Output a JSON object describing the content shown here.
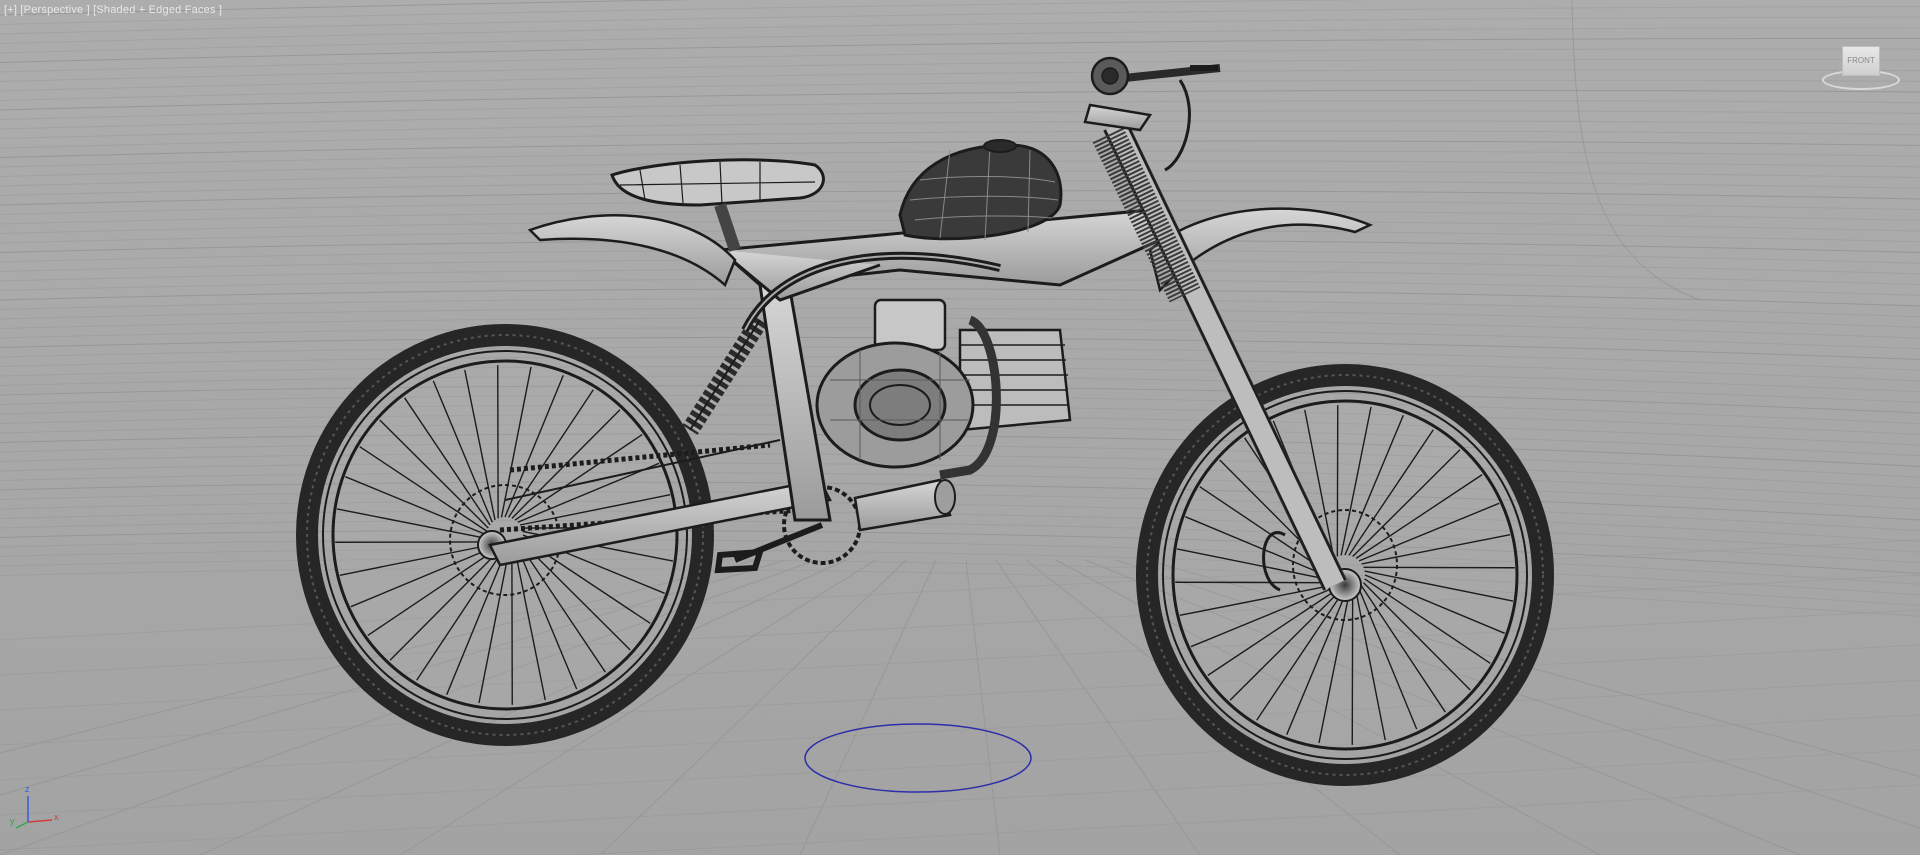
{
  "viewport": {
    "menu_label": "[+]",
    "view_label": "[Perspective ]",
    "shading_label": "[Shaded + Edged Faces ]",
    "viewcube_face": "FRONT",
    "axes": {
      "x": "x",
      "y": "y",
      "z": "z"
    }
  },
  "scene": {
    "object": "motorbike wireframe model",
    "background": "grey studio backdrop with wire grid",
    "selection_marker_color": "#2c2fa8"
  },
  "colors": {
    "background": "#a9a9a9",
    "wire": "#1c1c1c",
    "grid": "#8c8c8c",
    "label": "#e8e8e8",
    "axis_x": "#d23b3b",
    "axis_y": "#2fa84f",
    "axis_z": "#2f5fd8"
  }
}
